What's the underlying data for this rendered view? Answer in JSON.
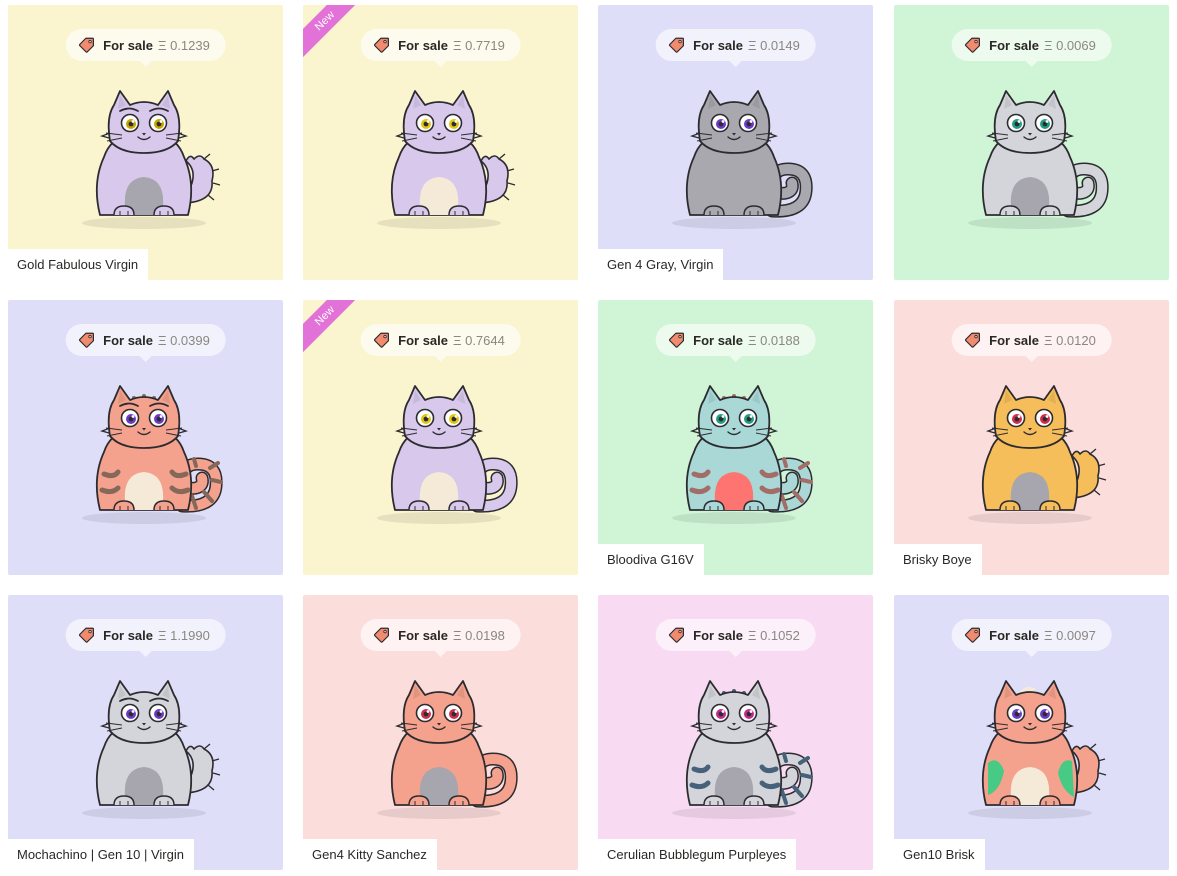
{
  "kitties": [
    {
      "price": "0.1239",
      "name": "Gold Fabulous Virgin",
      "isNew": false,
      "bg": "#faf4cf",
      "body": "#d8c9ec",
      "belly": "#a7a5ad",
      "eye": "#c8a400",
      "pattern": "none",
      "patternColor": "#d8c9ec",
      "tail": "fluffy",
      "eyebrow": true
    },
    {
      "price": "0.7719",
      "name": "",
      "isNew": true,
      "bg": "#faf4cf",
      "body": "#d8c9ec",
      "belly": "#f5ead8",
      "eye": "#e2c50e",
      "pattern": "none",
      "patternColor": "#d8c9ec",
      "tail": "fluffy",
      "eyebrow": false
    },
    {
      "price": "0.0149",
      "name": "Gen 4 Gray, Virgin",
      "isNew": false,
      "bg": "#dedef9",
      "body": "#a9a8ae",
      "belly": "#a9a8ae",
      "eye": "#6c3bc6",
      "pattern": "none",
      "patternColor": "#a9a8ae",
      "tail": "curl",
      "eyebrow": false
    },
    {
      "price": "0.0069",
      "name": "",
      "isNew": false,
      "bg": "#cff4d6",
      "body": "#d4d5da",
      "belly": "#a7a5ad",
      "eye": "#1f9e83",
      "pattern": "none",
      "patternColor": "#d4d5da",
      "tail": "curl",
      "eyebrow": false
    },
    {
      "price": "0.0399",
      "name": "",
      "isNew": false,
      "bg": "#dedef9",
      "body": "#f4a28d",
      "belly": "#f5ead8",
      "eye": "#6c3bc6",
      "pattern": "stripes",
      "patternColor": "#85685a",
      "tail": "striped-curl",
      "eyebrow": true
    },
    {
      "price": "0.7644",
      "name": "",
      "isNew": true,
      "bg": "#faf4cf",
      "body": "#d8c9ec",
      "belly": "#f5ead8",
      "eye": "#e2c50e",
      "pattern": "none",
      "patternColor": "#d8c9ec",
      "tail": "curl",
      "eyebrow": false
    },
    {
      "price": "0.0188",
      "name": "Bloodiva G16V",
      "isNew": false,
      "bg": "#cff4d6",
      "body": "#a9d8d7",
      "belly": "#fd7470",
      "eye": "#1f9e83",
      "pattern": "stripes",
      "patternColor": "#a16d66",
      "tail": "striped-curl",
      "eyebrow": false
    },
    {
      "price": "0.0120",
      "name": "Brisky Boye",
      "isNew": false,
      "bg": "#fbdddc",
      "body": "#f6be5a",
      "belly": "#a7a5ad",
      "eye": "#d02d4a",
      "pattern": "none",
      "patternColor": "#f6be5a",
      "tail": "fluffy",
      "eyebrow": false
    },
    {
      "price": "1.1990",
      "name": "Mochachino | Gen 10 | Virgin",
      "isNew": false,
      "bg": "#dedef9",
      "body": "#d4d5da",
      "belly": "#a7a5ad",
      "eye": "#6c3bc6",
      "pattern": "none",
      "patternColor": "#d4d5da",
      "tail": "fluffy",
      "eyebrow": true
    },
    {
      "price": "0.0198",
      "name": "Gen4 Kitty Sanchez",
      "isNew": false,
      "bg": "#fbdddc",
      "body": "#f4a28d",
      "belly": "#a7a5ad",
      "eye": "#d02d4a",
      "pattern": "none",
      "patternColor": "#f4a28d",
      "tail": "curl",
      "eyebrow": false
    },
    {
      "price": "0.1052",
      "name": "Cerulian Bubblegum Purpleyes",
      "isNew": false,
      "bg": "#f8dbf2",
      "body": "#d4d5da",
      "belly": "#a7a5ad",
      "eye": "#c42a8d",
      "pattern": "stripes",
      "patternColor": "#47617a",
      "tail": "striped-curl",
      "eyebrow": false
    },
    {
      "price": "0.0097",
      "name": "Gen10 Brisk",
      "isNew": false,
      "bg": "#dedef9",
      "body": "#f4a28d",
      "belly": "#f5ead8",
      "eye": "#6c3bc6",
      "pattern": "spots",
      "patternColor": "#3ccc84",
      "tail": "fluffy",
      "eyebrow": false
    }
  ],
  "labels": {
    "for_sale": "For sale",
    "currency_symbol": "Ξ",
    "new_ribbon": "New"
  },
  "icons": {
    "price_tag": "price-tag-icon"
  },
  "colors": {
    "tag_fill": "#f28b6d",
    "outline": "#2c2b30",
    "ribbon": "#e271d8"
  }
}
